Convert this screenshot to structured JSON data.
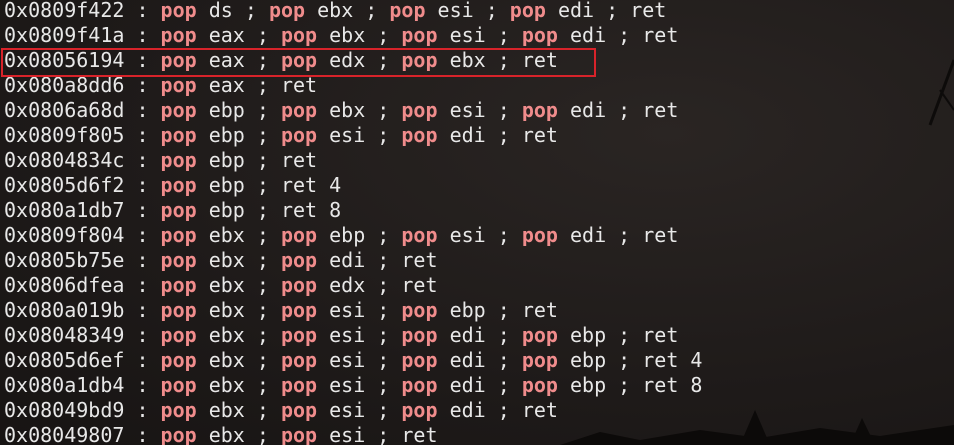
{
  "theme": {
    "keyword_color": "#f08c8c",
    "text_color": "#e8e8e8",
    "highlight_color": "#d8232a",
    "background": "#1f1b1a"
  },
  "gadgets": [
    {
      "addr": "0x0809f422",
      "parts": [
        [
          "pop",
          "ds"
        ],
        [
          "pop",
          "ebx"
        ],
        [
          "pop",
          "esi"
        ],
        [
          "pop",
          "edi"
        ],
        [
          "ret",
          ""
        ]
      ]
    },
    {
      "addr": "0x0809f41a",
      "parts": [
        [
          "pop",
          "eax"
        ],
        [
          "pop",
          "ebx"
        ],
        [
          "pop",
          "esi"
        ],
        [
          "pop",
          "edi"
        ],
        [
          "ret",
          ""
        ]
      ]
    },
    {
      "addr": "0x08056194",
      "parts": [
        [
          "pop",
          "eax"
        ],
        [
          "pop",
          "edx"
        ],
        [
          "pop",
          "ebx"
        ],
        [
          "ret",
          ""
        ]
      ],
      "highlighted": true
    },
    {
      "addr": "0x080a8dd6",
      "parts": [
        [
          "pop",
          "eax"
        ],
        [
          "ret",
          ""
        ]
      ]
    },
    {
      "addr": "0x0806a68d",
      "parts": [
        [
          "pop",
          "ebp"
        ],
        [
          "pop",
          "ebx"
        ],
        [
          "pop",
          "esi"
        ],
        [
          "pop",
          "edi"
        ],
        [
          "ret",
          ""
        ]
      ]
    },
    {
      "addr": "0x0809f805",
      "parts": [
        [
          "pop",
          "ebp"
        ],
        [
          "pop",
          "esi"
        ],
        [
          "pop",
          "edi"
        ],
        [
          "ret",
          ""
        ]
      ]
    },
    {
      "addr": "0x0804834c",
      "parts": [
        [
          "pop",
          "ebp"
        ],
        [
          "ret",
          ""
        ]
      ]
    },
    {
      "addr": "0x0805d6f2",
      "parts": [
        [
          "pop",
          "ebp"
        ],
        [
          "ret",
          "4"
        ]
      ]
    },
    {
      "addr": "0x080a1db7",
      "parts": [
        [
          "pop",
          "ebp"
        ],
        [
          "ret",
          "8"
        ]
      ]
    },
    {
      "addr": "0x0809f804",
      "parts": [
        [
          "pop",
          "ebx"
        ],
        [
          "pop",
          "ebp"
        ],
        [
          "pop",
          "esi"
        ],
        [
          "pop",
          "edi"
        ],
        [
          "ret",
          ""
        ]
      ]
    },
    {
      "addr": "0x0805b75e",
      "parts": [
        [
          "pop",
          "ebx"
        ],
        [
          "pop",
          "edi"
        ],
        [
          "ret",
          ""
        ]
      ]
    },
    {
      "addr": "0x0806dfea",
      "parts": [
        [
          "pop",
          "ebx"
        ],
        [
          "pop",
          "edx"
        ],
        [
          "ret",
          ""
        ]
      ]
    },
    {
      "addr": "0x080a019b",
      "parts": [
        [
          "pop",
          "ebx"
        ],
        [
          "pop",
          "esi"
        ],
        [
          "pop",
          "ebp"
        ],
        [
          "ret",
          ""
        ]
      ]
    },
    {
      "addr": "0x08048349",
      "parts": [
        [
          "pop",
          "ebx"
        ],
        [
          "pop",
          "esi"
        ],
        [
          "pop",
          "edi"
        ],
        [
          "pop",
          "ebp"
        ],
        [
          "ret",
          ""
        ]
      ]
    },
    {
      "addr": "0x0805d6ef",
      "parts": [
        [
          "pop",
          "ebx"
        ],
        [
          "pop",
          "esi"
        ],
        [
          "pop",
          "edi"
        ],
        [
          "pop",
          "ebp"
        ],
        [
          "ret",
          "4"
        ]
      ]
    },
    {
      "addr": "0x080a1db4",
      "parts": [
        [
          "pop",
          "ebx"
        ],
        [
          "pop",
          "esi"
        ],
        [
          "pop",
          "edi"
        ],
        [
          "pop",
          "ebp"
        ],
        [
          "ret",
          "8"
        ]
      ]
    },
    {
      "addr": "0x08049bd9",
      "parts": [
        [
          "pop",
          "ebx"
        ],
        [
          "pop",
          "esi"
        ],
        [
          "pop",
          "edi"
        ],
        [
          "ret",
          ""
        ]
      ]
    },
    {
      "addr": "0x08049807",
      "parts": [
        [
          "pop",
          "ebx"
        ],
        [
          "pop",
          "esi"
        ],
        [
          "ret",
          ""
        ]
      ]
    }
  ]
}
